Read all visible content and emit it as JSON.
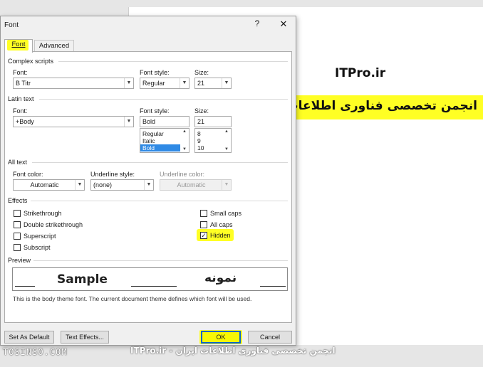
{
  "document": {
    "title": "ITPro.ir",
    "banner": "انجمن تخصصی فناوری اطلاعات"
  },
  "watermark": {
    "left": "TOSINSO.COM",
    "right": "انجمن تخصصی فناوری اطلاعات ایران - ITPro.ir"
  },
  "dialog": {
    "title": "Font",
    "help": "?",
    "close": "✕",
    "tabs": {
      "font": "Font",
      "advanced": "Advanced"
    },
    "complex": {
      "section": "Complex scripts",
      "font_label": "Font:",
      "font_value": "B Titr",
      "style_label": "Font style:",
      "style_value": "Regular",
      "size_label": "Size:",
      "size_value": "21"
    },
    "latin": {
      "section": "Latin text",
      "font_label": "Font:",
      "font_value": "+Body",
      "style_label": "Font style:",
      "style_value": "Bold",
      "style_options": [
        "Regular",
        "Italic",
        "Bold"
      ],
      "size_label": "Size:",
      "size_value": "21",
      "size_options": [
        "8",
        "9",
        "10"
      ]
    },
    "all_text": {
      "section": "All text",
      "color_label": "Font color:",
      "color_value": "Automatic",
      "underline_label": "Underline style:",
      "underline_value": "(none)",
      "ucolor_label": "Underline color:",
      "ucolor_value": "Automatic"
    },
    "effects": {
      "section": "Effects",
      "strikethrough": "Strikethrough",
      "double_strikethrough": "Double strikethrough",
      "superscript": "Superscript",
      "subscript": "Subscript",
      "small_caps": "Small caps",
      "all_caps": "All caps",
      "hidden": "Hidden",
      "hidden_checked": true
    },
    "preview": {
      "section": "Preview",
      "sample_latin": "Sample",
      "sample_complex": "نمونه",
      "note": "This is the body theme font. The current document theme defines which font will be used."
    },
    "buttons": {
      "set_default": "Set As Default",
      "text_effects": "Text Effects...",
      "ok": "OK",
      "cancel": "Cancel"
    }
  },
  "colors": {
    "highlight": "#ffff24",
    "selection": "#2f8ae5",
    "ok_border": "#0a64c8"
  }
}
